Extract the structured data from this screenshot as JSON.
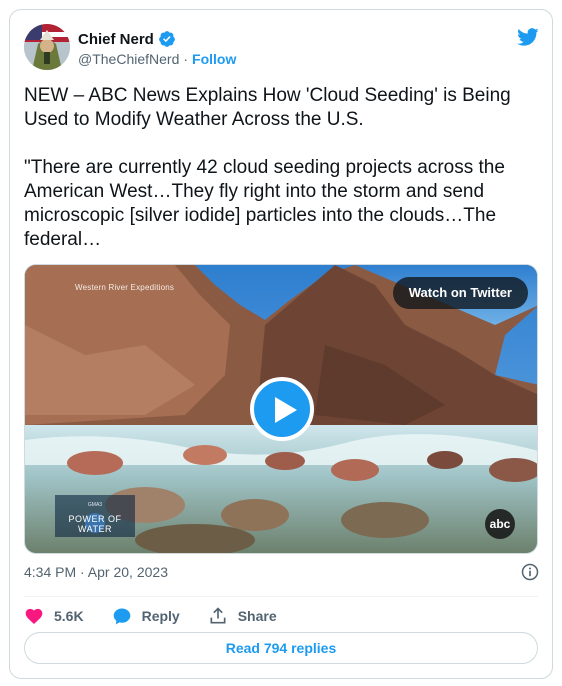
{
  "author": {
    "name": "Chief Nerd",
    "handle": "@TheChiefNerd",
    "separator": "·",
    "follow_label": "Follow"
  },
  "tweet": {
    "text": "NEW – ABC News Explains How 'Cloud Seeding' is Being Used to Modify Weather Across the U.S.\n\n\"There are currently 42 cloud seeding projects across the American West…They fly right into the storm and send microscopic [silver iodide] particles into the clouds…The federal…"
  },
  "media": {
    "watermark": "Western River Expeditions",
    "watch_label": "Watch on Twitter",
    "series_small": "GMA3",
    "series_title": "POWER OF WATER",
    "network_logo": "abc"
  },
  "meta": {
    "timestamp": "4:34 PM · Apr 20, 2023"
  },
  "actions": {
    "likes": "5.6K",
    "reply_label": "Reply",
    "share_label": "Share"
  },
  "read_replies": "Read 794 replies",
  "colors": {
    "accent": "#1d9bf0",
    "like": "#f91880",
    "text": "#0f1419",
    "secondary": "#536471"
  },
  "icons": [
    "verified-badge-icon",
    "twitter-bird-icon",
    "play-icon",
    "info-icon",
    "heart-icon",
    "reply-bubble-icon",
    "share-icon"
  ]
}
